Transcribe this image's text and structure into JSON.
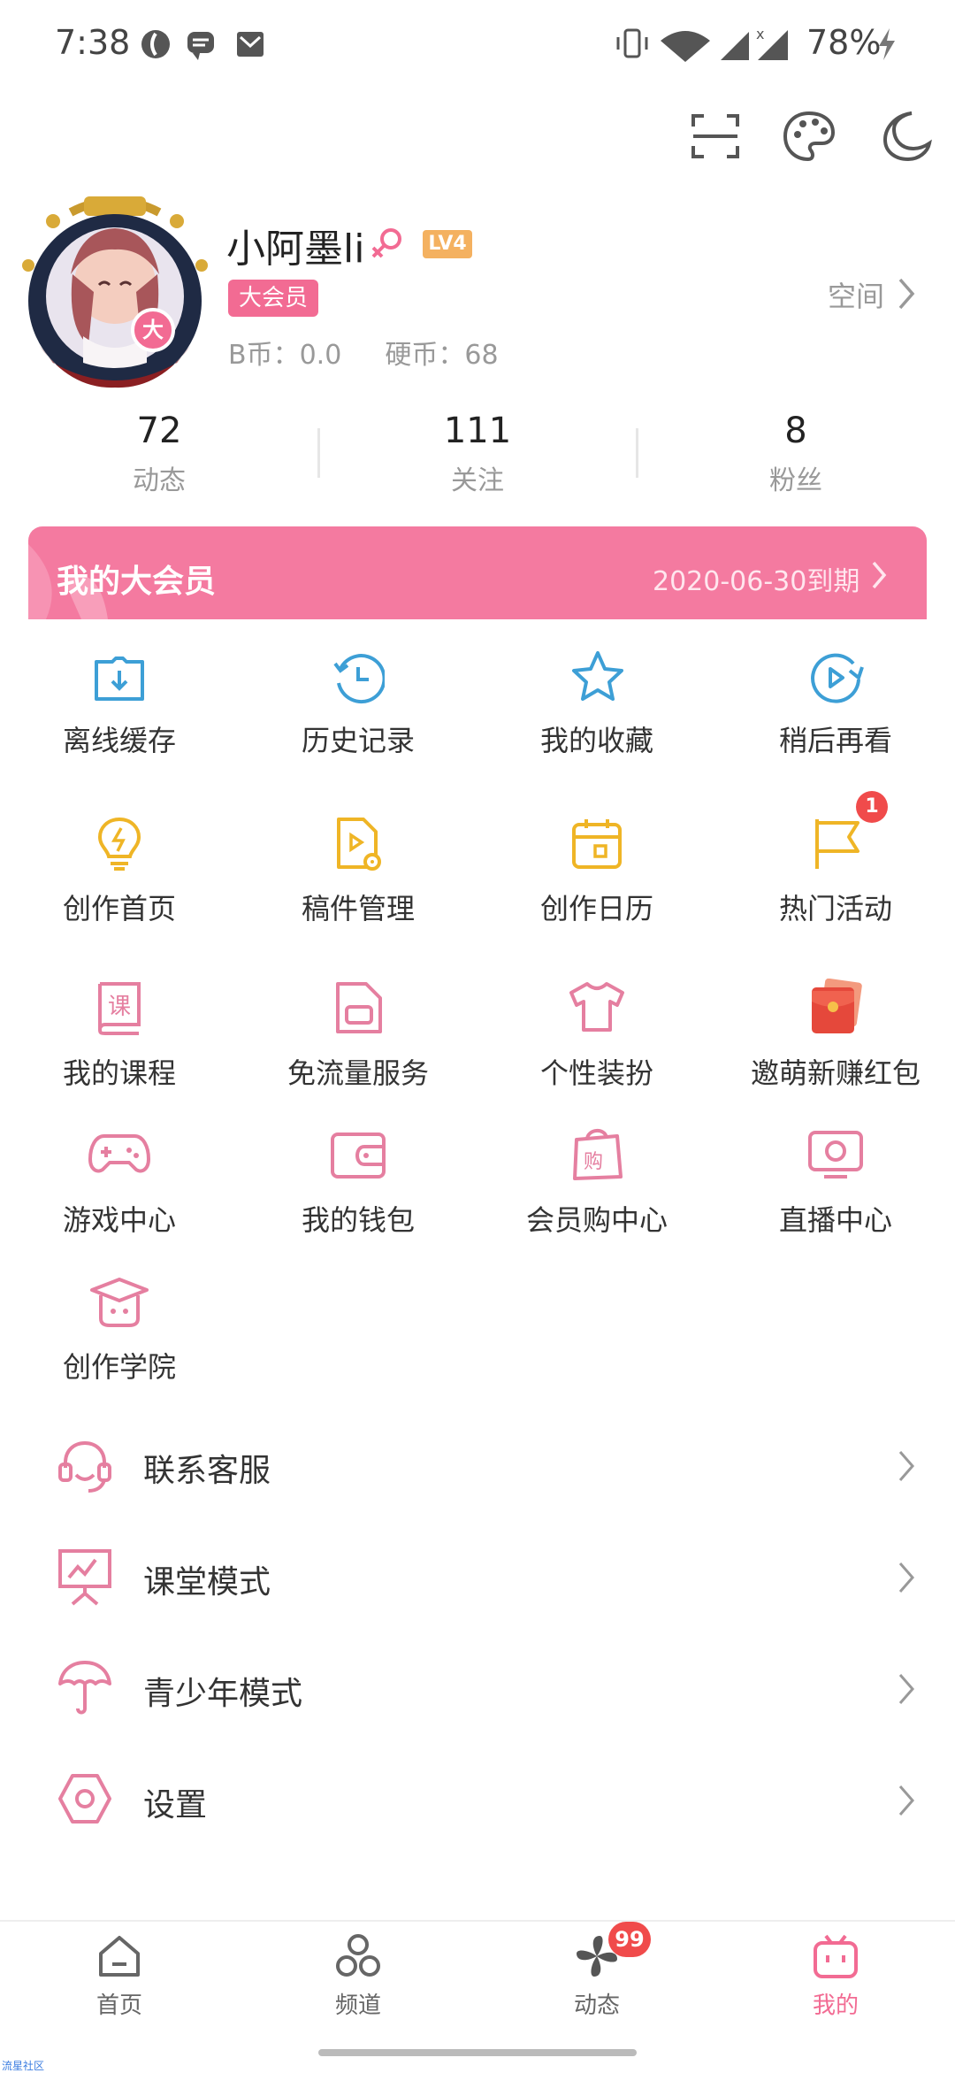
{
  "status": {
    "time": "7:38",
    "battery": "78%"
  },
  "header_icons": [
    "scan-icon",
    "palette-icon",
    "night-mode-icon"
  ],
  "profile": {
    "name": "小阿墨li",
    "level": "LV4",
    "vip_badge": "大会员",
    "avatar_badge": "大",
    "coins": "B币：0.0",
    "hard_coins": "硬币：68",
    "space_link": "空间"
  },
  "stats": [
    {
      "value": "72",
      "label": "动态"
    },
    {
      "value": "111",
      "label": "关注"
    },
    {
      "value": "8",
      "label": "粉丝"
    }
  ],
  "vip_banner": {
    "title": "我的大会员",
    "expiry": "2020-06-30到期"
  },
  "grid": [
    {
      "label": "离线缓存",
      "icon": "offline-cache-icon",
      "color": "#3d9fd6"
    },
    {
      "label": "历史记录",
      "icon": "history-icon",
      "color": "#3d9fd6"
    },
    {
      "label": "我的收藏",
      "icon": "favorites-icon",
      "color": "#3d9fd6"
    },
    {
      "label": "稍后再看",
      "icon": "watch-later-icon",
      "color": "#3d9fd6"
    },
    {
      "label": "创作首页",
      "icon": "creation-home-icon",
      "color": "#efb526"
    },
    {
      "label": "稿件管理",
      "icon": "manuscript-icon",
      "color": "#efb526"
    },
    {
      "label": "创作日历",
      "icon": "calendar-icon",
      "color": "#efb526"
    },
    {
      "label": "热门活动",
      "icon": "flag-icon",
      "color": "#efb526",
      "badge": "1"
    },
    {
      "label": "我的课程",
      "icon": "course-icon",
      "color": "#e57fa0"
    },
    {
      "label": "免流量服务",
      "icon": "sim-card-icon",
      "color": "#e57fa0"
    },
    {
      "label": "个性装扮",
      "icon": "tshirt-icon",
      "color": "#e57fa0"
    },
    {
      "label": "邀萌新赚红包",
      "icon": "red-envelope-icon",
      "color": "#e5483b"
    },
    {
      "label": "游戏中心",
      "icon": "gamepad-icon",
      "color": "#e57fa0"
    },
    {
      "label": "我的钱包",
      "icon": "wallet-icon",
      "color": "#e57fa0"
    },
    {
      "label": "会员购中心",
      "icon": "shopping-bag-icon",
      "color": "#e57fa0"
    },
    {
      "label": "直播中心",
      "icon": "live-icon",
      "color": "#e57fa0"
    },
    {
      "label": "创作学院",
      "icon": "academy-icon",
      "color": "#e57fa0"
    }
  ],
  "list": [
    {
      "label": "联系客服",
      "icon": "headset-icon"
    },
    {
      "label": "课堂模式",
      "icon": "classroom-icon"
    },
    {
      "label": "青少年模式",
      "icon": "umbrella-icon"
    },
    {
      "label": "设置",
      "icon": "settings-icon"
    }
  ],
  "tabs": [
    {
      "label": "首页",
      "icon": "home-icon"
    },
    {
      "label": "频道",
      "icon": "channel-icon"
    },
    {
      "label": "动态",
      "icon": "dynamic-icon",
      "badge": "99"
    },
    {
      "label": "我的",
      "icon": "my-icon",
      "active": true
    }
  ],
  "colors": {
    "accent": "#f26b93",
    "blue": "#3d9fd6",
    "yellow": "#efb526",
    "pink": "#e57fa0"
  },
  "watermark": "流星社区"
}
